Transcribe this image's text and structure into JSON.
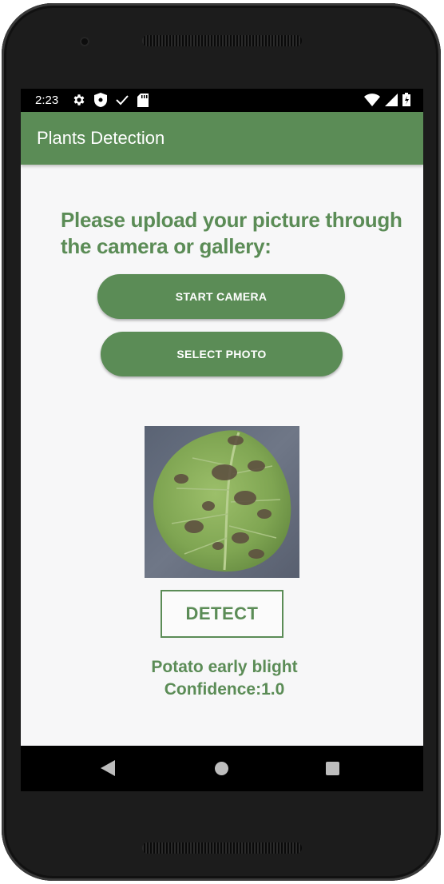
{
  "status_bar": {
    "time": "2:23",
    "left_icons": [
      "settings-icon",
      "shield-icon",
      "check-icon",
      "sd-card-icon"
    ],
    "right_icons": [
      "wifi-icon",
      "signal-icon",
      "battery-icon"
    ]
  },
  "app_bar": {
    "title": "Plants Detection"
  },
  "main": {
    "prompt": "Please upload your picture through the camera or gallery:",
    "start_camera_label": "START CAMERA",
    "select_photo_label": "SELECT PHOTO",
    "detect_label": "DETECT",
    "result_line1": "Potato early blight",
    "result_line2": "Confidence:1.0"
  },
  "nav_bar": {
    "icons": [
      "back-icon",
      "home-icon",
      "recents-icon"
    ]
  },
  "colors": {
    "accent": "#5b8c56",
    "background": "#f7f7f8"
  }
}
